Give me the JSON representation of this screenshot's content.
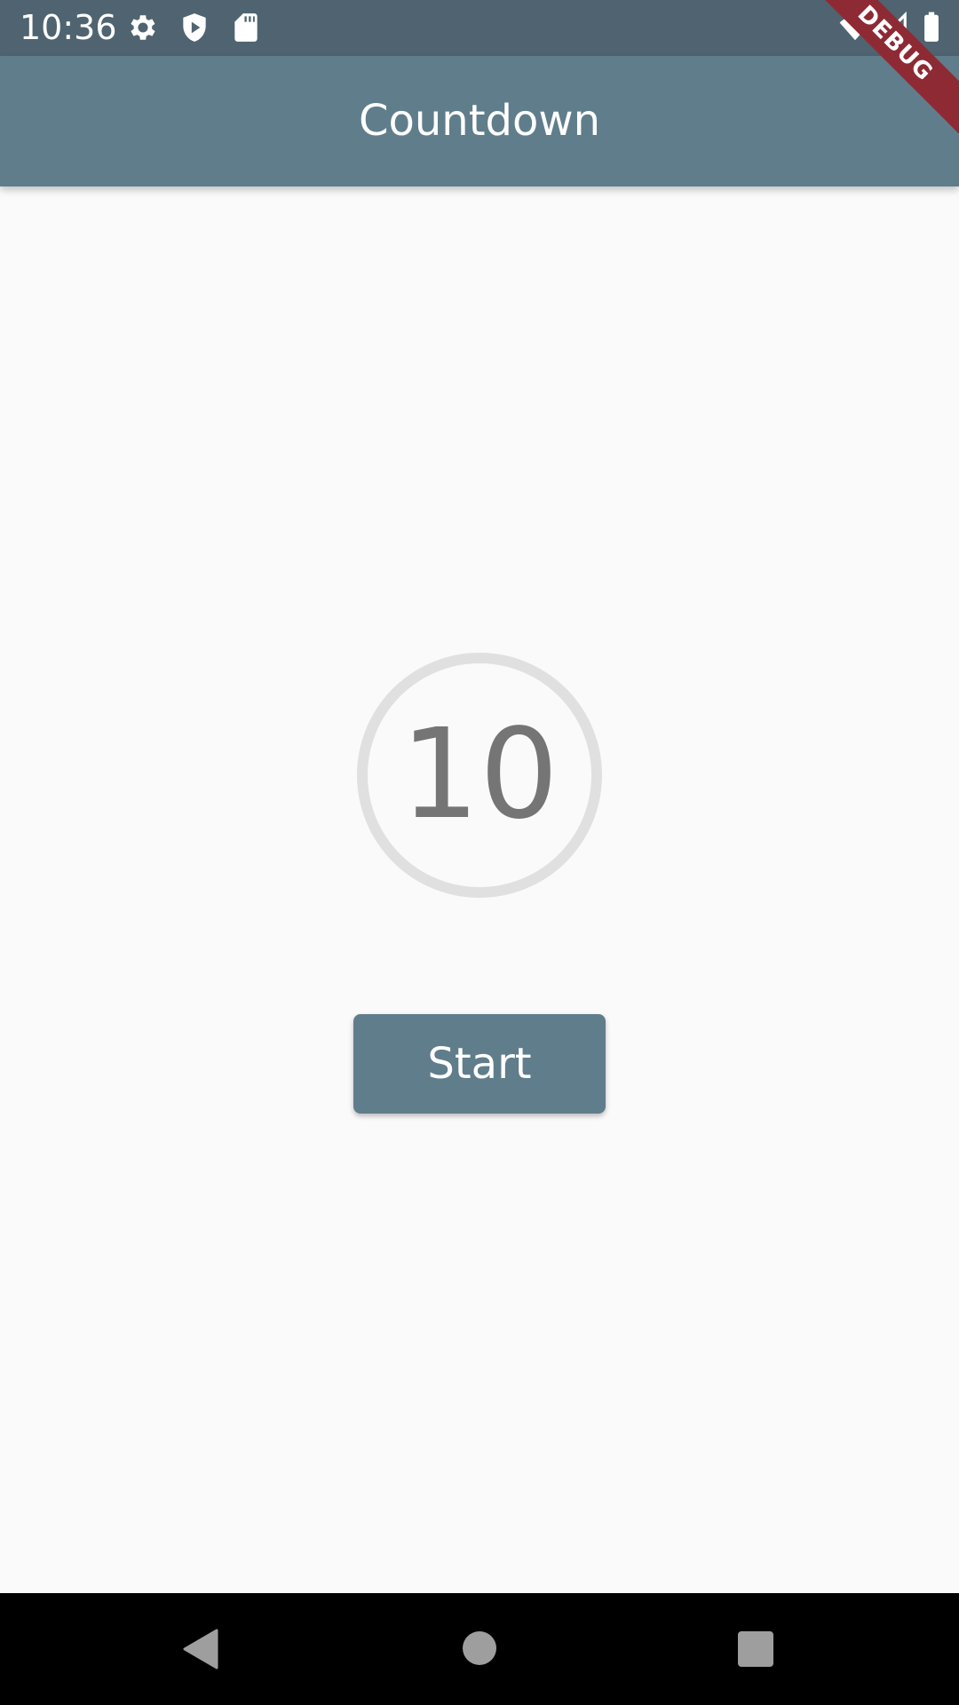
{
  "status_bar": {
    "time": "10:36",
    "left_icons": [
      "gear-icon",
      "shield-play-icon",
      "sd-card-icon"
    ],
    "right_icons": [
      "wifi-icon",
      "cell-signal-icon",
      "battery-icon"
    ]
  },
  "app_bar": {
    "title": "Countdown"
  },
  "debug_banner": {
    "label": "DEBUG"
  },
  "countdown": {
    "value": "10"
  },
  "actions": {
    "start_label": "Start"
  },
  "nav_bar": {
    "icons": [
      "back-icon",
      "home-icon",
      "recents-icon"
    ]
  },
  "colors": {
    "primary": "#607d8b",
    "status_bar": "#4f6470",
    "background": "#fafafa",
    "ring": "#e0e0e0",
    "countdown_text": "#757575",
    "debug_ribbon": "#8e2a34"
  }
}
